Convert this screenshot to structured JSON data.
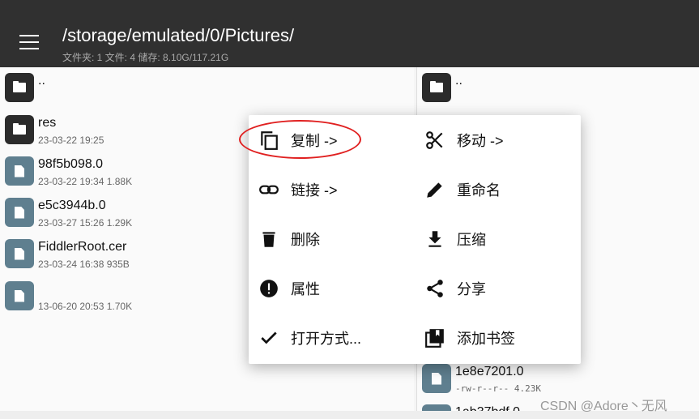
{
  "header": {
    "path": "/storage/emulated/0/Pictures/",
    "stats": "文件夹: 1  文件: 4  储存: 8.10G/117.21G"
  },
  "left_pane": {
    "items": [
      {
        "name": "..",
        "meta": "",
        "type": "folder"
      },
      {
        "name": "res",
        "meta": "23-03-22 19:25",
        "type": "folder"
      },
      {
        "name": "98f5b098.0",
        "meta": "23-03-22 19:34  1.88K",
        "type": "file"
      },
      {
        "name": "e5c3944b.0",
        "meta": "23-03-27 15:26  1.29K",
        "type": "file"
      },
      {
        "name": "FiddlerRoot.cer",
        "meta": "23-03-24 16:38  935B",
        "type": "file"
      },
      {
        "name": "",
        "meta": "13-06-20 20:53  1.70K",
        "type": "file"
      }
    ]
  },
  "right_pane": {
    "items": [
      {
        "name": "..",
        "meta": "",
        "type": "folder"
      },
      {
        "name": "1e8e7201.0",
        "meta": "-rw-r--r--  4.23K",
        "type": "file"
      },
      {
        "name": "1ab37bdf.0",
        "meta": "",
        "type": "file"
      }
    ]
  },
  "context_menu": {
    "items": [
      {
        "label": "复制 ->",
        "icon": "copy-icon"
      },
      {
        "label": "移动 ->",
        "icon": "scissors-icon"
      },
      {
        "label": "链接 ->",
        "icon": "link-icon"
      },
      {
        "label": "重命名",
        "icon": "pencil-icon"
      },
      {
        "label": "删除",
        "icon": "trash-icon"
      },
      {
        "label": "压缩",
        "icon": "download-icon"
      },
      {
        "label": "属性",
        "icon": "info-icon"
      },
      {
        "label": "分享",
        "icon": "share-icon"
      },
      {
        "label": "打开方式...",
        "icon": "check-icon"
      },
      {
        "label": "添加书签",
        "icon": "bookmark-icon"
      }
    ],
    "highlighted": "复制 ->",
    "highlight_color": "#e02020"
  },
  "watermark": "CSDN @Adore丶无风"
}
